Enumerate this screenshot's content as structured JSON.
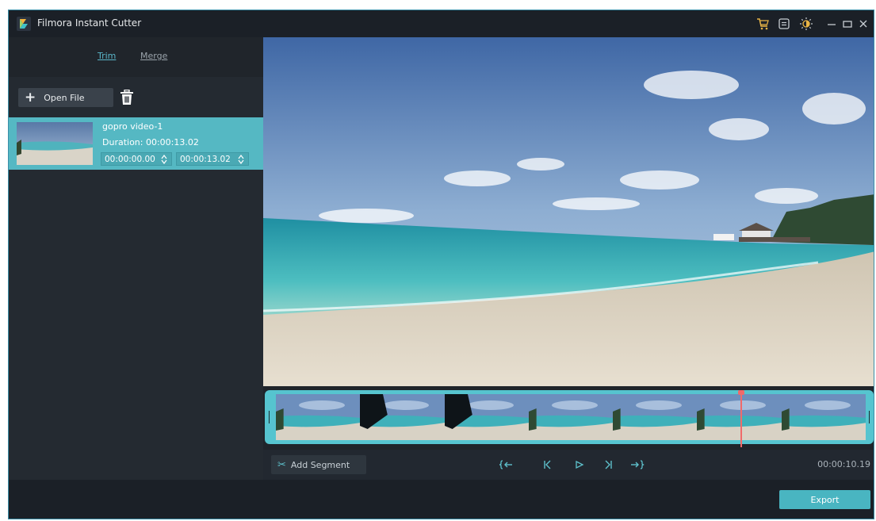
{
  "app": {
    "title": "Filmora Instant Cutter"
  },
  "titlebar": {
    "icons": [
      "cart-icon",
      "register-icon",
      "brightness-icon",
      "minimize-icon",
      "maximize-icon",
      "close-icon"
    ]
  },
  "tabs": {
    "trim": "Trim",
    "merge": "Merge",
    "active": "trim"
  },
  "toolbar": {
    "open_file": "Open File",
    "open_icon": "plus-icon",
    "delete_icon": "trash-icon"
  },
  "file": {
    "name": "gopro video-1",
    "duration": "Duration: 00:00:13.02",
    "start": "00:00:00.00",
    "end": "00:00:13.02"
  },
  "timeline": {
    "frame_count": 7,
    "playhead_fraction": 0.787
  },
  "controls": {
    "add_segment": "Add Segment",
    "timecode": "00:00:10.19",
    "buttons": [
      "mark-in-icon",
      "previous-frame-icon",
      "play-icon",
      "next-frame-icon",
      "mark-out-icon"
    ]
  },
  "footer": {
    "export": "Export"
  },
  "colors": {
    "accent": "#55b8c3",
    "background": "#222830",
    "titlebar": "#1b2027",
    "playhead": "#f06a6a"
  }
}
